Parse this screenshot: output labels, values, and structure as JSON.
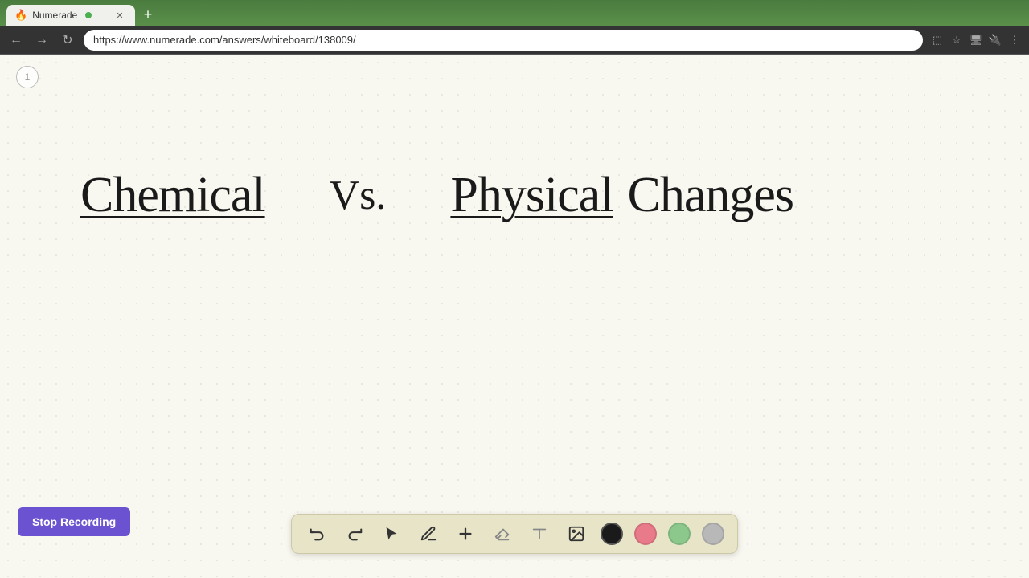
{
  "browser": {
    "tab_title": "Numerade",
    "tab_add_label": "+",
    "url": "https://www.numerade.com/answers/whiteboard/138009/",
    "nav": {
      "back": "←",
      "forward": "→",
      "reload": "↺"
    }
  },
  "whiteboard": {
    "page_number": "1",
    "title_chemical": "Chemical",
    "title_vs": "Vs.",
    "title_physical": "Physical",
    "title_changes": "Changes"
  },
  "toolbar": {
    "undo_label": "↺",
    "redo_label": "↻",
    "stop_recording_label": "Stop Recording",
    "colors": {
      "black": "#1a1a1a",
      "pink": "#e87a8a",
      "green": "#8cc88c",
      "gray": "#b8b8b8"
    }
  }
}
